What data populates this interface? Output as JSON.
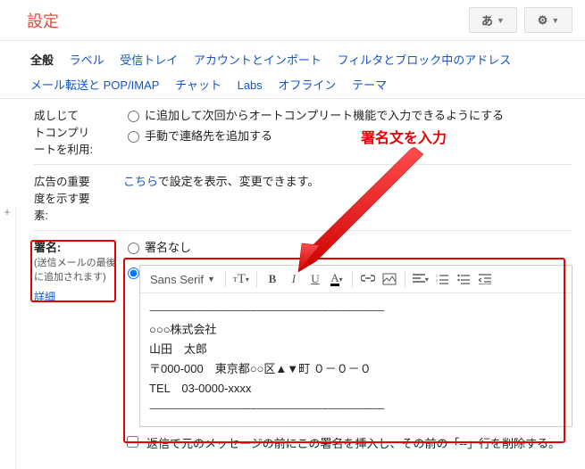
{
  "header": {
    "title": "設定",
    "lang_btn": "あ",
    "gear": "⚙"
  },
  "tabs": [
    "全般",
    "ラベル",
    "受信トレイ",
    "アカウントとインポート",
    "フィルタとブロック中のアドレス",
    "メール転送と POP/IMAP",
    "チャット",
    "Labs",
    "オフライン",
    "テーマ"
  ],
  "autocomplete": {
    "label_l1": "成しじて",
    "label_l2": "トコンプリ",
    "label_l3": "ートを利用:",
    "truncated": "に追加して次回からオートコンプリート機能で入力できるようにする",
    "manual": "手動で連絡先を追加する"
  },
  "ads": {
    "label_l1": "広告の重要",
    "label_l2": "度を示す要",
    "label_l3": "素:",
    "link": "こちら",
    "text": "で設定を表示、変更できます。"
  },
  "signature": {
    "label": "署名:",
    "sub": "(送信メールの最後に追加されます)",
    "details": "詳細",
    "none": "署名なし",
    "toolbar": {
      "font": "Sans Serif"
    },
    "body": {
      "hr": "-------------------------------------------------------------------------------",
      "l1": "○○○株式会社",
      "l2": "山田　太郎",
      "l3": "〒000-000　東京都○○区▲▼町 ０－０－０",
      "l4": "TEL　03-0000-xxxx"
    },
    "reply_cb": "返信で元のメッセージの前にこの署名を挿入し、その前の「--」行を削除する。"
  },
  "annotation": "署名文を入力"
}
